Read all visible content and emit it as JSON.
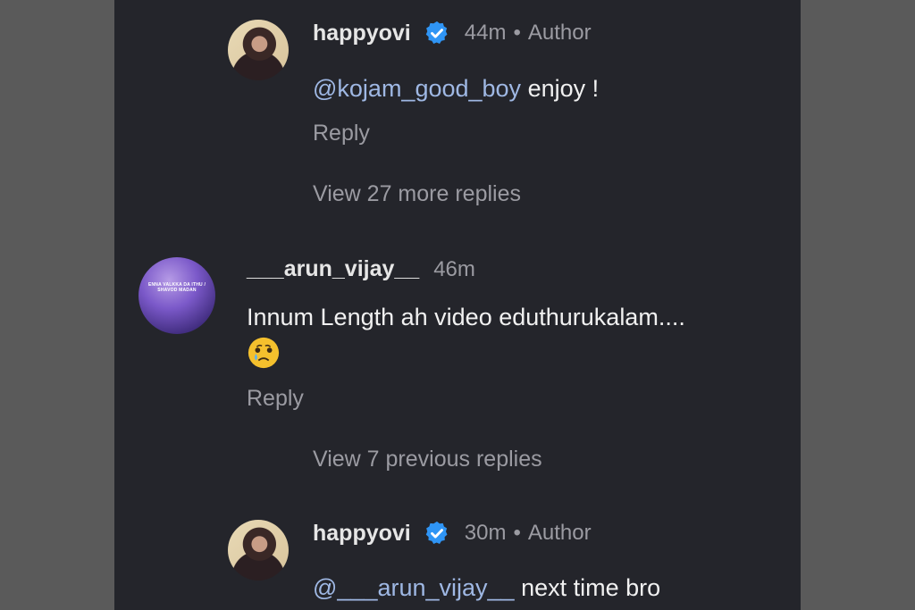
{
  "comments": [
    {
      "username": "happyovi",
      "time": "44m",
      "separator": "•",
      "role": "Author",
      "mention": "@kojam_good_boy",
      "text": " enjoy !",
      "reply_label": "Reply"
    },
    {
      "username": "___arun_vijay__",
      "time": "46m",
      "text": "Innum Length ah video eduthurukalam....",
      "emoji": "crying-face",
      "reply_label": "Reply",
      "avatar_text": "ENNA VALKKA DA ITHU / SHAVOD MADAN"
    },
    {
      "username": "happyovi",
      "time": "30m",
      "separator": "•",
      "role": "Author",
      "mention": "@___arun_vijay__",
      "text": " next time bro"
    }
  ],
  "view_more": "View 27 more replies",
  "view_previous": "View 7 previous replies",
  "colors": {
    "background": "#24252b",
    "outer": "#5a5a5a",
    "mention": "#9fb8e4",
    "verified": "#2f95f5",
    "muted": "#9b9ba2"
  }
}
